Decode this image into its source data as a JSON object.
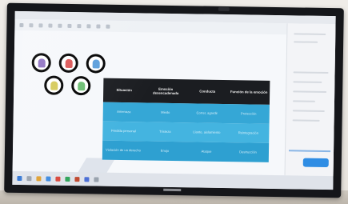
{
  "scene": {
    "description_free": true
  },
  "slide": {
    "table": {
      "headers": [
        "Situación",
        "Emoción desencadenada",
        "Conducta",
        "Función de la emoción"
      ],
      "rows": [
        [
          "Amenaza",
          "Miedo",
          "Correr, agredir",
          "Protección"
        ],
        [
          "Pérdida personal",
          "Tristeza",
          "Llanto, aislamiento",
          "Reintegración"
        ],
        [
          "Violación de un derecho",
          "Enojo",
          "Ataque",
          "Destrucción"
        ]
      ]
    },
    "emotion_icons": [
      {
        "name": "purple",
        "color": "#7d5bb8"
      },
      {
        "name": "red",
        "color": "#d63a3a"
      },
      {
        "name": "blue",
        "color": "#3f8ed6"
      },
      {
        "name": "yellow",
        "color": "#e0d24a"
      },
      {
        "name": "green",
        "color": "#53b35a"
      }
    ]
  }
}
